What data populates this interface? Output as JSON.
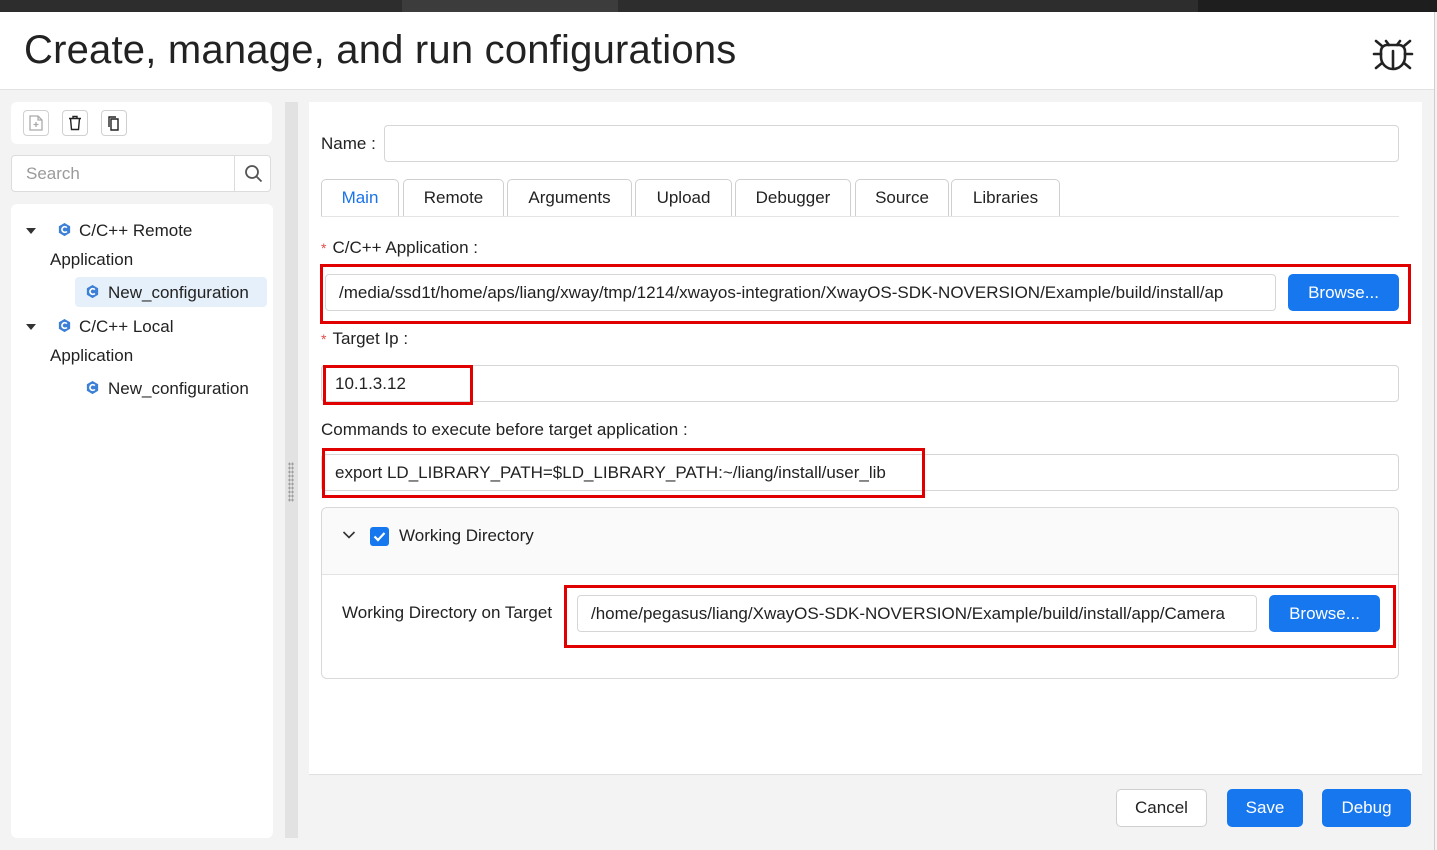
{
  "header": {
    "title": "Create, manage, and run configurations",
    "debug_icon": "bug-icon"
  },
  "toolbar": {
    "icons": [
      "new-file-icon",
      "trash-icon",
      "duplicate-icon"
    ]
  },
  "search": {
    "placeholder": "Search"
  },
  "tree": {
    "nodes": [
      {
        "label_line1": "C/C++ Remote",
        "label_line2": "Application",
        "child": "New_configuration"
      },
      {
        "label_line1": "C/C++ Local",
        "label_line2": "Application",
        "child": "New_configuration"
      }
    ]
  },
  "form": {
    "name_label": "Name",
    "name_value": "",
    "tabs": [
      "Main",
      "Remote",
      "Arguments",
      "Upload",
      "Debugger",
      "Source",
      "Libraries"
    ],
    "active_tab": "Main",
    "app_label": "C/C++ Application",
    "app_value": "/media/ssd1t/home/aps/liang/xway/tmp/1214/xwayos-integration/XwayOS-SDK-NOVERSION/Example/build/install/ap",
    "browse_label": "Browse...",
    "target_ip_label": "Target Ip",
    "target_ip_value": "10.1.3.12",
    "commands_label": "Commands to execute before target application",
    "commands_value": "export LD_LIBRARY_PATH=$LD_LIBRARY_PATH:~/liang/install/user_lib",
    "wd_header": "Working Directory",
    "wd_checked": true,
    "wd_target_label": "Working Directory on Target",
    "wd_target_value": "/home/pegasus/liang/XwayOS-SDK-NOVERSION/Example/build/install/app/Camera",
    "wd_browse_label": "Browse...",
    "colon": ":"
  },
  "footer": {
    "cancel": "Cancel",
    "save": "Save",
    "debug": "Debug"
  },
  "colors": {
    "accent": "#1677ee",
    "highlight": "#e00000"
  }
}
